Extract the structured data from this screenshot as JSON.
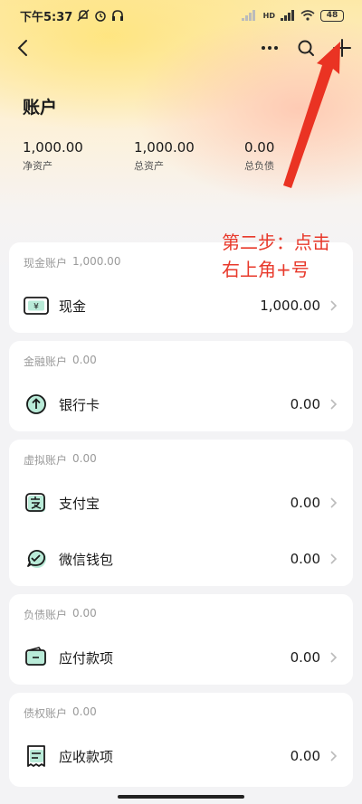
{
  "status_bar": {
    "time": "下午5:37",
    "signal_text": "HD",
    "battery": "48"
  },
  "header": {
    "title": "账户"
  },
  "summary": [
    {
      "value": "1,000.00",
      "label": "净资产"
    },
    {
      "value": "1,000.00",
      "label": "总资产"
    },
    {
      "value": "0.00",
      "label": "总负债"
    }
  ],
  "annotation": {
    "line1": "第二步：点击",
    "line2": "右上角+号"
  },
  "sections": [
    {
      "title": "现金账户",
      "total": "1,000.00",
      "items": [
        {
          "name": "现金",
          "amount": "1,000.00",
          "icon": "cash-icon"
        }
      ]
    },
    {
      "title": "金融账户",
      "total": "0.00",
      "items": [
        {
          "name": "银行卡",
          "amount": "0.00",
          "icon": "bank-card-icon"
        }
      ]
    },
    {
      "title": "虚拟账户",
      "total": "0.00",
      "items": [
        {
          "name": "支付宝",
          "amount": "0.00",
          "icon": "alipay-icon"
        },
        {
          "name": "微信钱包",
          "amount": "0.00",
          "icon": "wechat-wallet-icon"
        }
      ]
    },
    {
      "title": "负债账户",
      "total": "0.00",
      "items": [
        {
          "name": "应付款项",
          "amount": "0.00",
          "icon": "payable-icon"
        }
      ]
    },
    {
      "title": "债权账户",
      "total": "0.00",
      "items": [
        {
          "name": "应收款项",
          "amount": "0.00",
          "icon": "receivable-icon"
        }
      ]
    }
  ],
  "colors": {
    "annotation": "#e8392b",
    "accent_green": "#2e9e6a"
  }
}
